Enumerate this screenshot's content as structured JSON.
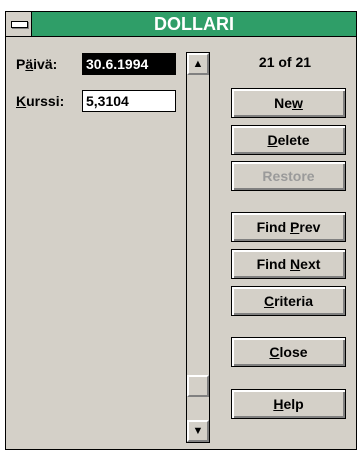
{
  "window": {
    "title": "DOLLARI"
  },
  "fields": {
    "date_label_pre": "P",
    "date_label_accel": "ä",
    "date_label_post": "ivä:",
    "date_value": "30.6.1994",
    "rate_label_accel": "K",
    "rate_label_post": "urssi:",
    "rate_value": "5,3104"
  },
  "record_counter": "21 of 21",
  "buttons": {
    "new": {
      "pre": "Ne",
      "accel": "w",
      "post": ""
    },
    "delete": {
      "pre": "",
      "accel": "D",
      "post": "elete"
    },
    "restore": {
      "label": "Restore",
      "enabled": false
    },
    "find_prev": {
      "pre": "Find ",
      "accel": "P",
      "post": "rev"
    },
    "find_next": {
      "pre": "Find ",
      "accel": "N",
      "post": "ext"
    },
    "criteria": {
      "pre": "",
      "accel": "C",
      "post": "riteria"
    },
    "close": {
      "pre": "",
      "accel": "C",
      "post": "lose"
    },
    "help": {
      "pre": "",
      "accel": "H",
      "post": "elp"
    }
  },
  "scrollbar": {
    "up_glyph": "▲",
    "down_glyph": "▼",
    "position": 1.0
  },
  "icons": {
    "system_menu": "system-menu-icon",
    "scroll_up": "arrow-up-icon",
    "scroll_down": "arrow-down-icon"
  }
}
